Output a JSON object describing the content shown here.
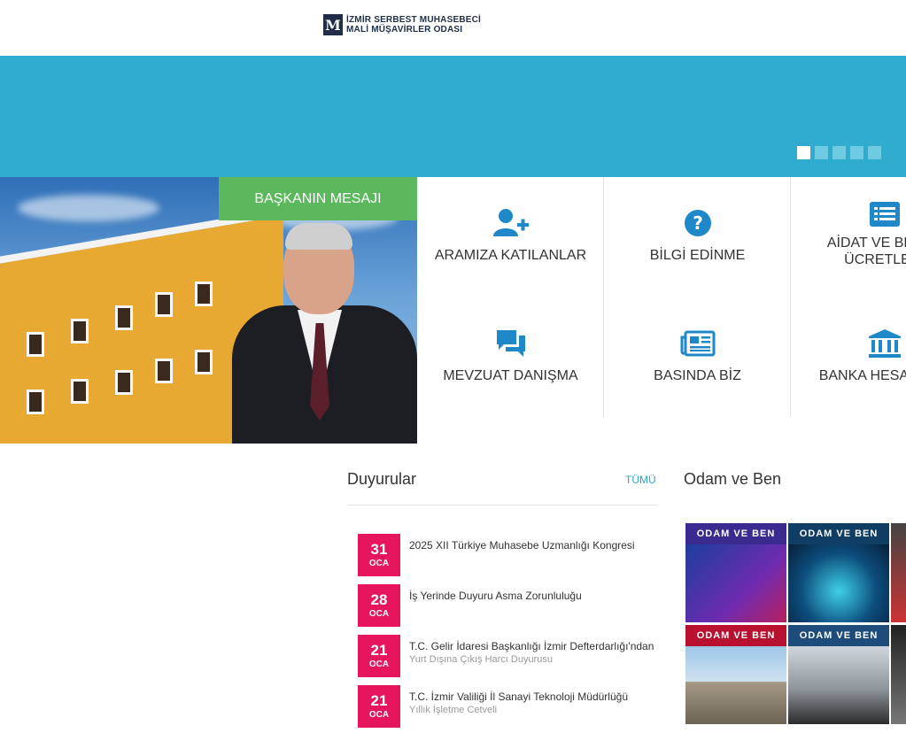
{
  "header": {
    "logo_line1": "İZMİR SERBEST MUHASEBECİ",
    "logo_line2": "MALİ MÜŞAVİRLER ODASI",
    "logo_mark": "M"
  },
  "slider": {
    "dots": 5,
    "active_index": 0
  },
  "president": {
    "button_label": "BAŞKANIN MESAJI"
  },
  "quick_links": [
    {
      "label": "ARAMIZA KATILANLAR",
      "icon": "user-plus-icon"
    },
    {
      "label": "BİLGİ EDİNME",
      "icon": "question-circle-icon"
    },
    {
      "label": "AİDAT VE BELGE ÜCRETLERİ",
      "icon": "list-icon"
    },
    {
      "label": "MEVZUAT DANIŞMA",
      "icon": "chat-icon"
    },
    {
      "label": "BASINDA BİZ",
      "icon": "newspaper-icon"
    },
    {
      "label": "BANKA HESAPLARI",
      "icon": "bank-icon"
    }
  ],
  "announcements": {
    "title": "Duyurular",
    "all_label": "TÜMÜ",
    "items": [
      {
        "day": "31",
        "month": "OCA",
        "title": "2025 XII Türkiye Muhasebe Uzmanlığı Kongresi",
        "subtitle": ""
      },
      {
        "day": "28",
        "month": "OCA",
        "title": "İş Yerinde Duyuru Asma Zorunluluğu",
        "subtitle": ""
      },
      {
        "day": "21",
        "month": "OCA",
        "title": "T.C. Gelir İdaresi Başkanlığı İzmir Defterdarlığı'ndan",
        "subtitle": "Yurt Dışına Çıkış Harcı Duyurusu"
      },
      {
        "day": "21",
        "month": "OCA",
        "title": "T.C. İzmir Valiliği İl Sanayi Teknoloji Müdürlüğü",
        "subtitle": "Yıllık İşletme Cetveli"
      }
    ]
  },
  "odam": {
    "title": "Odam ve Ben",
    "cards": [
      {
        "label": "ODAM VE BEN"
      },
      {
        "label": "ODAM VE BEN"
      },
      {
        "label": "ODAM VE BEN"
      },
      {
        "label": "ODAM VE BEN"
      }
    ]
  },
  "colors": {
    "banner": "#30adce",
    "accent_green": "#5cb85c",
    "date_badge": "#e6155d",
    "icon_blue": "#1e88c9",
    "link": "#30a5cc"
  }
}
